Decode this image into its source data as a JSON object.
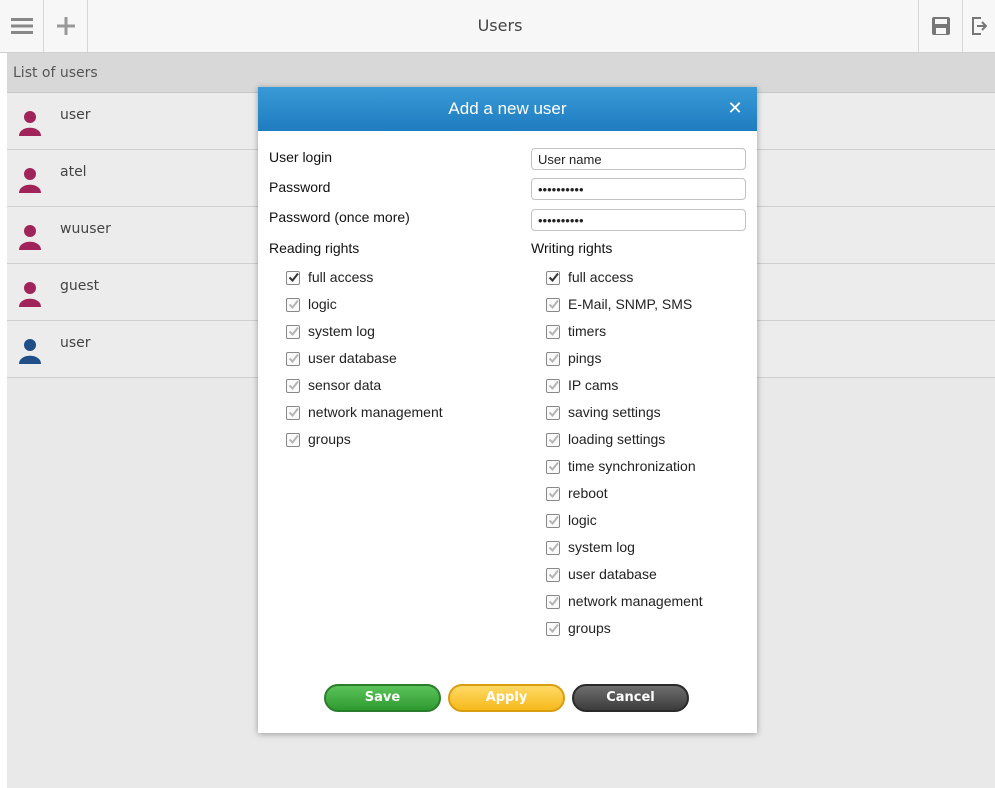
{
  "topbar": {
    "title": "Users",
    "left_icons": [
      "menu-icon",
      "plus-icon"
    ],
    "right_icons": [
      "save-disk-icon",
      "logout-icon"
    ]
  },
  "list": {
    "header": "List of users",
    "users": [
      {
        "name": "user",
        "avatar_color": "#a0245a"
      },
      {
        "name": "atel",
        "avatar_color": "#a0245a"
      },
      {
        "name": "wuuser",
        "avatar_color": "#a0245a"
      },
      {
        "name": "guest",
        "avatar_color": "#a0245a"
      },
      {
        "name": "user",
        "avatar_color": "#1f4f86"
      }
    ]
  },
  "modal": {
    "title": "Add a new user",
    "close_icon": "close-icon",
    "fields": {
      "login_label": "User login",
      "login_value": "User name",
      "password_label": "Password",
      "password_value": "••••••••••",
      "password2_label": "Password (once more)",
      "password2_value": "••••••••••"
    },
    "reading": {
      "title": "Reading rights",
      "items": [
        {
          "label": "full access",
          "checked": true
        },
        {
          "label": "logic",
          "checked": true
        },
        {
          "label": "system log",
          "checked": true
        },
        {
          "label": "user database",
          "checked": true
        },
        {
          "label": "sensor data",
          "checked": true
        },
        {
          "label": "network management",
          "checked": true
        },
        {
          "label": "groups",
          "checked": true
        }
      ]
    },
    "writing": {
      "title": "Writing rights",
      "items": [
        {
          "label": "full access",
          "checked": true
        },
        {
          "label": "E-Mail, SNMP, SMS",
          "checked": true
        },
        {
          "label": "timers",
          "checked": true
        },
        {
          "label": "pings",
          "checked": true
        },
        {
          "label": "IP cams",
          "checked": true
        },
        {
          "label": "saving settings",
          "checked": true
        },
        {
          "label": "loading settings",
          "checked": true
        },
        {
          "label": "time synchronization",
          "checked": true
        },
        {
          "label": "reboot",
          "checked": true
        },
        {
          "label": "logic",
          "checked": true
        },
        {
          "label": "system log",
          "checked": true
        },
        {
          "label": "user database",
          "checked": true
        },
        {
          "label": "network management",
          "checked": true
        },
        {
          "label": "groups",
          "checked": true
        }
      ]
    },
    "buttons": {
      "save": "Save",
      "apply": "Apply",
      "cancel": "Cancel"
    },
    "colors": {
      "header": "#1e7cc0",
      "save": "#2f9a2f",
      "apply": "#f6b91b",
      "cancel": "#3c3c3c"
    }
  }
}
